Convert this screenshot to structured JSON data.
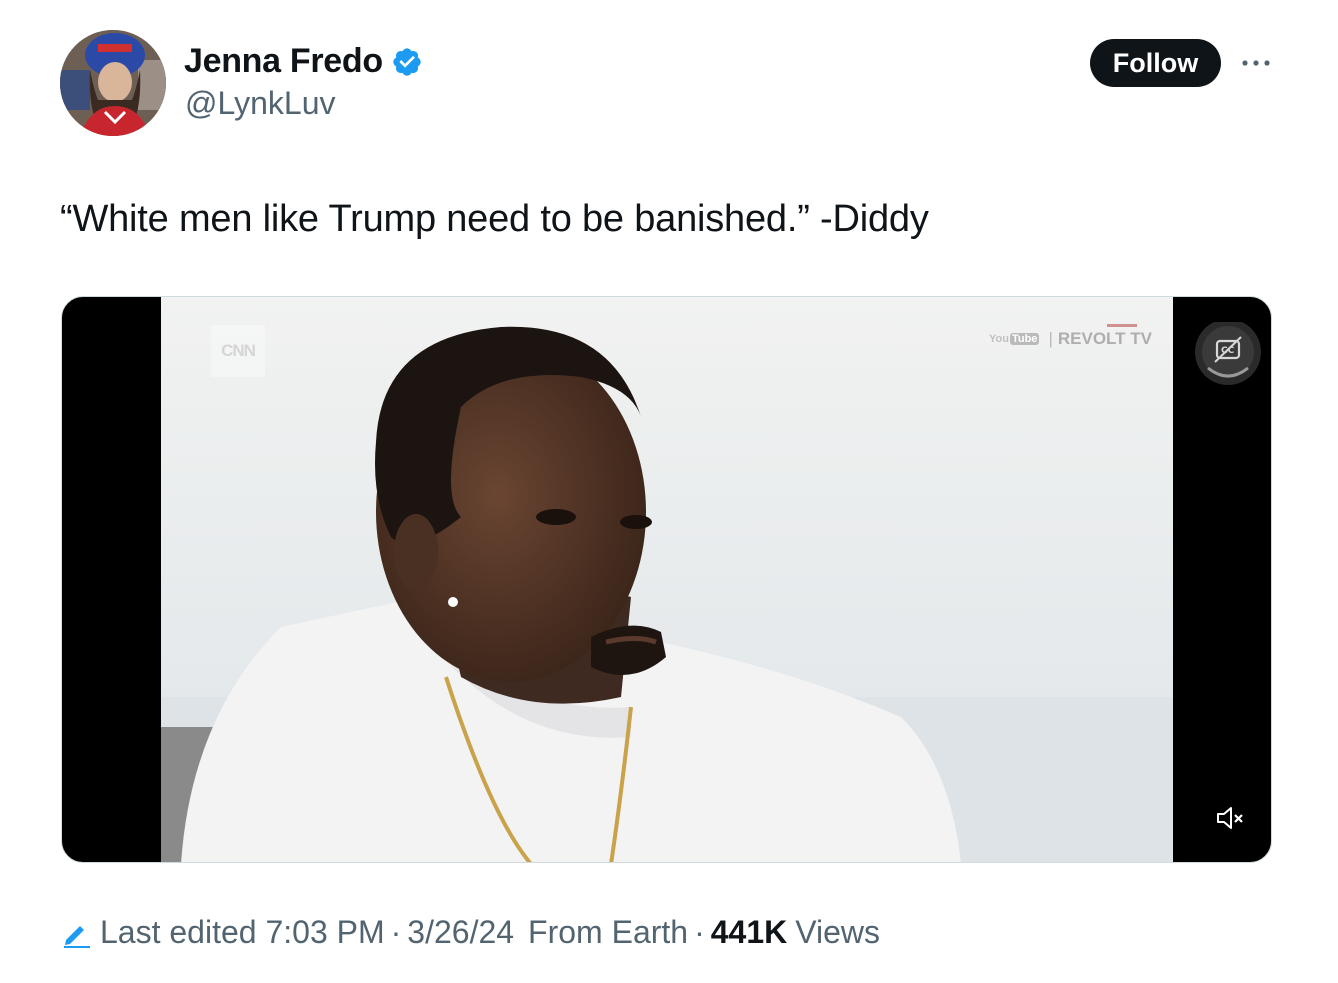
{
  "author": {
    "name": "Jenna Fredo",
    "handle": "@LynkLuv",
    "verified": true
  },
  "actions": {
    "follow_label": "Follow"
  },
  "tweet": {
    "text": "“White men like Trump need to be banished.” -Diddy"
  },
  "media": {
    "channel_logo": "CNN",
    "watermark_prefix": "You",
    "watermark_tube": "Tube",
    "watermark_separator": "|",
    "watermark_channel": "REVOLT TV",
    "icons": [
      "captions-icon",
      "mute-icon"
    ]
  },
  "footer": {
    "edited_label": "Last edited 7:03 PM",
    "separator": "·",
    "date": "3/26/24",
    "location": "From Earth",
    "views_count": "441K",
    "views_label": "Views"
  },
  "colors": {
    "text_primary": "#0f1419",
    "text_secondary": "#536471",
    "verified_blue": "#1d9bf0",
    "follow_bg": "#0f1419"
  }
}
